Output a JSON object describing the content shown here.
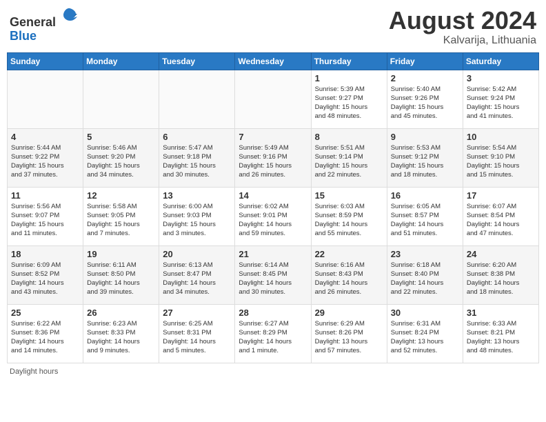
{
  "header": {
    "logo_general": "General",
    "logo_blue": "Blue",
    "month": "August 2024",
    "location": "Kalvarija, Lithuania"
  },
  "days_of_week": [
    "Sunday",
    "Monday",
    "Tuesday",
    "Wednesday",
    "Thursday",
    "Friday",
    "Saturday"
  ],
  "weeks": [
    [
      {
        "day": "",
        "info": ""
      },
      {
        "day": "",
        "info": ""
      },
      {
        "day": "",
        "info": ""
      },
      {
        "day": "",
        "info": ""
      },
      {
        "day": "1",
        "info": "Sunrise: 5:39 AM\nSunset: 9:27 PM\nDaylight: 15 hours\nand 48 minutes."
      },
      {
        "day": "2",
        "info": "Sunrise: 5:40 AM\nSunset: 9:26 PM\nDaylight: 15 hours\nand 45 minutes."
      },
      {
        "day": "3",
        "info": "Sunrise: 5:42 AM\nSunset: 9:24 PM\nDaylight: 15 hours\nand 41 minutes."
      }
    ],
    [
      {
        "day": "4",
        "info": "Sunrise: 5:44 AM\nSunset: 9:22 PM\nDaylight: 15 hours\nand 37 minutes."
      },
      {
        "day": "5",
        "info": "Sunrise: 5:46 AM\nSunset: 9:20 PM\nDaylight: 15 hours\nand 34 minutes."
      },
      {
        "day": "6",
        "info": "Sunrise: 5:47 AM\nSunset: 9:18 PM\nDaylight: 15 hours\nand 30 minutes."
      },
      {
        "day": "7",
        "info": "Sunrise: 5:49 AM\nSunset: 9:16 PM\nDaylight: 15 hours\nand 26 minutes."
      },
      {
        "day": "8",
        "info": "Sunrise: 5:51 AM\nSunset: 9:14 PM\nDaylight: 15 hours\nand 22 minutes."
      },
      {
        "day": "9",
        "info": "Sunrise: 5:53 AM\nSunset: 9:12 PM\nDaylight: 15 hours\nand 18 minutes."
      },
      {
        "day": "10",
        "info": "Sunrise: 5:54 AM\nSunset: 9:10 PM\nDaylight: 15 hours\nand 15 minutes."
      }
    ],
    [
      {
        "day": "11",
        "info": "Sunrise: 5:56 AM\nSunset: 9:07 PM\nDaylight: 15 hours\nand 11 minutes."
      },
      {
        "day": "12",
        "info": "Sunrise: 5:58 AM\nSunset: 9:05 PM\nDaylight: 15 hours\nand 7 minutes."
      },
      {
        "day": "13",
        "info": "Sunrise: 6:00 AM\nSunset: 9:03 PM\nDaylight: 15 hours\nand 3 minutes."
      },
      {
        "day": "14",
        "info": "Sunrise: 6:02 AM\nSunset: 9:01 PM\nDaylight: 14 hours\nand 59 minutes."
      },
      {
        "day": "15",
        "info": "Sunrise: 6:03 AM\nSunset: 8:59 PM\nDaylight: 14 hours\nand 55 minutes."
      },
      {
        "day": "16",
        "info": "Sunrise: 6:05 AM\nSunset: 8:57 PM\nDaylight: 14 hours\nand 51 minutes."
      },
      {
        "day": "17",
        "info": "Sunrise: 6:07 AM\nSunset: 8:54 PM\nDaylight: 14 hours\nand 47 minutes."
      }
    ],
    [
      {
        "day": "18",
        "info": "Sunrise: 6:09 AM\nSunset: 8:52 PM\nDaylight: 14 hours\nand 43 minutes."
      },
      {
        "day": "19",
        "info": "Sunrise: 6:11 AM\nSunset: 8:50 PM\nDaylight: 14 hours\nand 39 minutes."
      },
      {
        "day": "20",
        "info": "Sunrise: 6:13 AM\nSunset: 8:47 PM\nDaylight: 14 hours\nand 34 minutes."
      },
      {
        "day": "21",
        "info": "Sunrise: 6:14 AM\nSunset: 8:45 PM\nDaylight: 14 hours\nand 30 minutes."
      },
      {
        "day": "22",
        "info": "Sunrise: 6:16 AM\nSunset: 8:43 PM\nDaylight: 14 hours\nand 26 minutes."
      },
      {
        "day": "23",
        "info": "Sunrise: 6:18 AM\nSunset: 8:40 PM\nDaylight: 14 hours\nand 22 minutes."
      },
      {
        "day": "24",
        "info": "Sunrise: 6:20 AM\nSunset: 8:38 PM\nDaylight: 14 hours\nand 18 minutes."
      }
    ],
    [
      {
        "day": "25",
        "info": "Sunrise: 6:22 AM\nSunset: 8:36 PM\nDaylight: 14 hours\nand 14 minutes."
      },
      {
        "day": "26",
        "info": "Sunrise: 6:23 AM\nSunset: 8:33 PM\nDaylight: 14 hours\nand 9 minutes."
      },
      {
        "day": "27",
        "info": "Sunrise: 6:25 AM\nSunset: 8:31 PM\nDaylight: 14 hours\nand 5 minutes."
      },
      {
        "day": "28",
        "info": "Sunrise: 6:27 AM\nSunset: 8:29 PM\nDaylight: 14 hours\nand 1 minute."
      },
      {
        "day": "29",
        "info": "Sunrise: 6:29 AM\nSunset: 8:26 PM\nDaylight: 13 hours\nand 57 minutes."
      },
      {
        "day": "30",
        "info": "Sunrise: 6:31 AM\nSunset: 8:24 PM\nDaylight: 13 hours\nand 52 minutes."
      },
      {
        "day": "31",
        "info": "Sunrise: 6:33 AM\nSunset: 8:21 PM\nDaylight: 13 hours\nand 48 minutes."
      }
    ]
  ],
  "footer": {
    "daylight_label": "Daylight hours"
  }
}
